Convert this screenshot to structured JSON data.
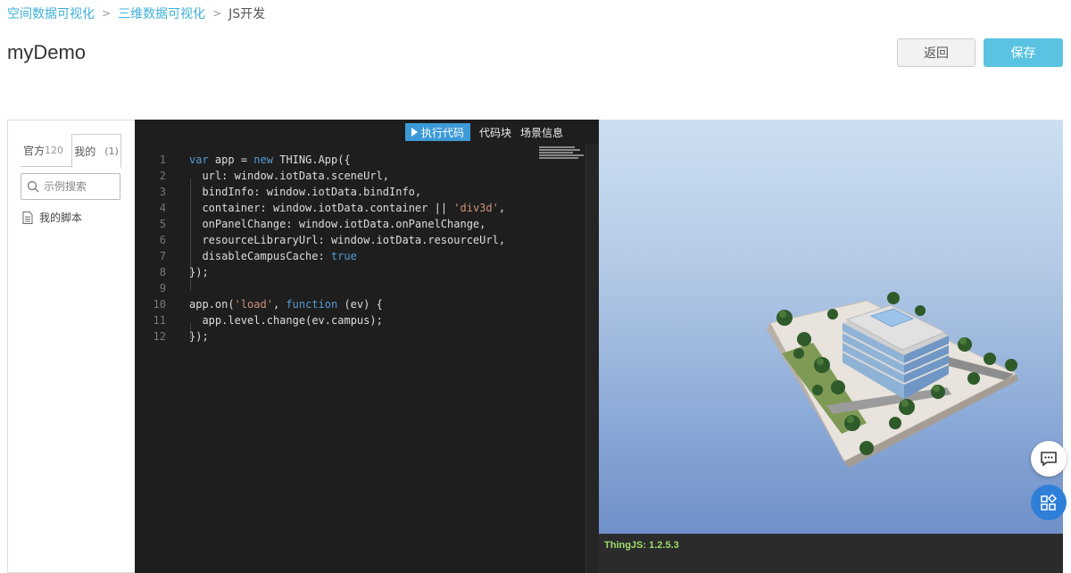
{
  "breadcrumb": {
    "items": [
      "空间数据可视化",
      "三维数据可视化"
    ],
    "current": "JS开发"
  },
  "page": {
    "title": "myDemo"
  },
  "actions": {
    "back_label": "返回",
    "save_label": "保存"
  },
  "sidebar": {
    "tabs": [
      {
        "label": "官方",
        "count": "120"
      },
      {
        "label": "我的",
        "count": "(1)"
      }
    ],
    "search_placeholder": "示例搜索",
    "scripts": [
      "我的脚本"
    ]
  },
  "editor": {
    "toolbar": {
      "run_label": "执行代码",
      "snippets_label": "代码块",
      "scene_info_label": "场景信息"
    },
    "lines": [
      {
        "n": "1",
        "text": "var app = new THING.App({"
      },
      {
        "n": "2",
        "text": "  url: window.iotData.sceneUrl,"
      },
      {
        "n": "3",
        "text": "  bindInfo: window.iotData.bindInfo,"
      },
      {
        "n": "4",
        "text": "  container: window.iotData.container || 'div3d',"
      },
      {
        "n": "5",
        "text": "  onPanelChange: window.iotData.onPanelChange,"
      },
      {
        "n": "6",
        "text": "  resourceLibraryUrl: window.iotData.resourceUrl,"
      },
      {
        "n": "7",
        "text": "  disableCampusCache: true"
      },
      {
        "n": "8",
        "text": "});"
      },
      {
        "n": "9",
        "text": ""
      },
      {
        "n": "10",
        "text": "app.on('load', function (ev) {"
      },
      {
        "n": "11",
        "text": "  app.level.change(ev.campus);"
      },
      {
        "n": "12",
        "text": "});"
      }
    ]
  },
  "viewport": {
    "status_text": "ThingJS: 1.2.5.3"
  },
  "colors": {
    "accent": "#5bc3e2",
    "link": "#3fb0d8",
    "editor_bg": "#1e1e1e",
    "status_text": "#9fdc6a"
  }
}
